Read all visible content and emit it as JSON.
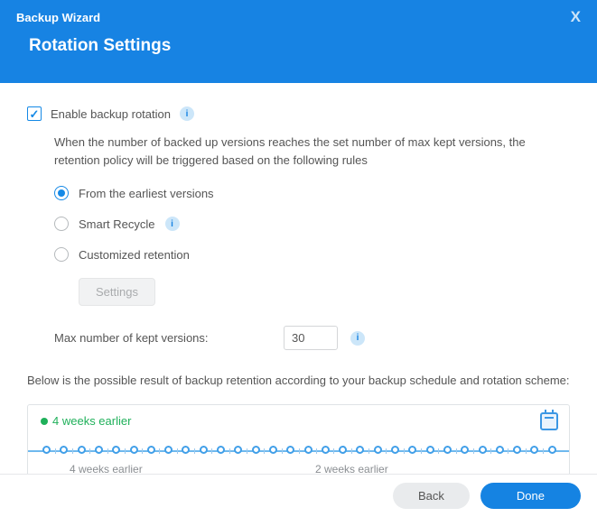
{
  "header": {
    "app_title": "Backup Wizard",
    "page_title": "Rotation Settings"
  },
  "enable": {
    "label": "Enable backup rotation",
    "checked": true,
    "description": "When the number of backed up versions reaches the set number of max kept versions, the retention policy will be triggered based on the following rules"
  },
  "radio": {
    "earliest": "From the earliest versions",
    "smart": "Smart Recycle",
    "custom": "Customized retention"
  },
  "settings_btn": "Settings",
  "max_versions": {
    "label": "Max number of kept versions:",
    "value": "30"
  },
  "below_text": "Below is the possible result of backup retention according to your backup schedule and rotation scheme:",
  "timeline": {
    "green_label": "4 weeks earlier",
    "label_left": "4 weeks earlier",
    "label_right": "2 weeks earlier"
  },
  "footer": {
    "back": "Back",
    "done": "Done"
  },
  "info_char": "i"
}
